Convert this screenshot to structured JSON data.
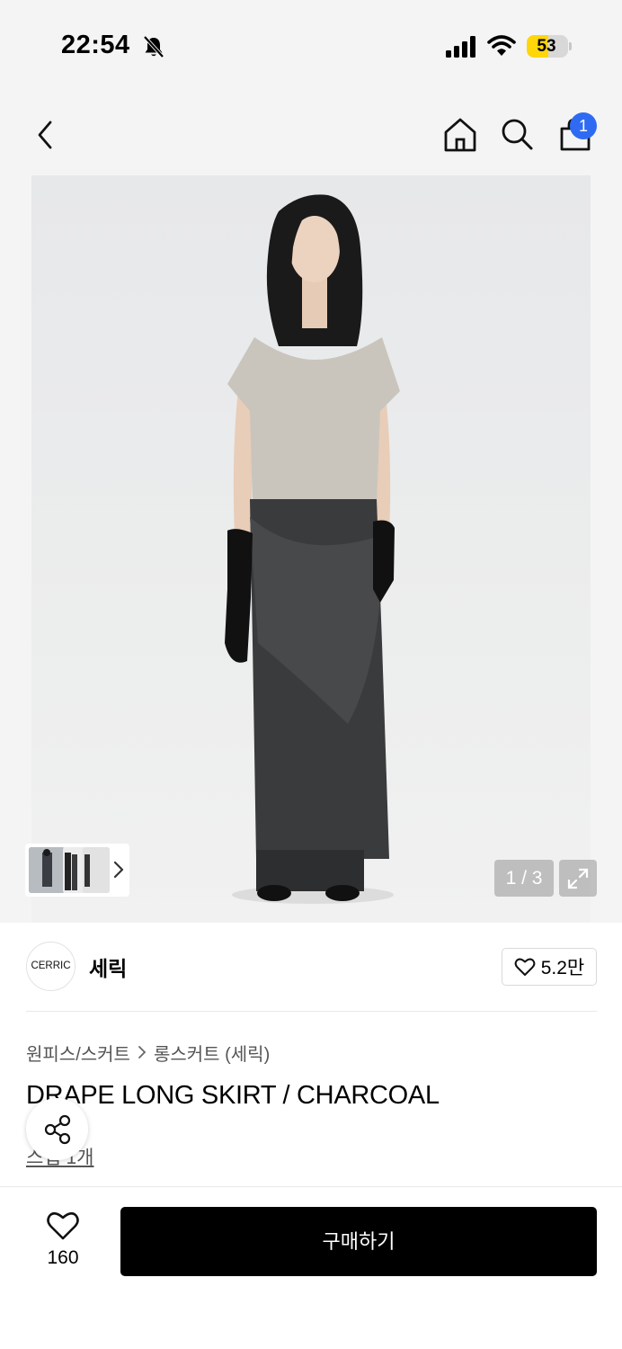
{
  "status_bar": {
    "time": "22:54",
    "battery_level": "53",
    "battery_fraction": 0.53,
    "battery_color": "#ffd60a",
    "icons": [
      "bell-slash-icon",
      "signal-icon",
      "wifi-icon",
      "battery-icon"
    ]
  },
  "nav": {
    "icons": [
      "chevron-left-icon",
      "home-icon",
      "search-icon",
      "shopping-bag-icon"
    ],
    "cart_count": "1",
    "badge_color": "#2e6bf2"
  },
  "gallery": {
    "counter": "1 / 3",
    "current": 1,
    "total": 3,
    "icons": [
      "chevron-right-icon",
      "expand-icon"
    ]
  },
  "brand": {
    "logo_text": "CERRIC",
    "name": "세릭",
    "like_count": "5.2만"
  },
  "product": {
    "breadcrumb": [
      "원피스/스커트",
      "롱스커트 (세릭)"
    ],
    "title": "DRAPE LONG SKIRT / CHARCOAL",
    "review_link": "스냅 1개"
  },
  "bottom_bar": {
    "wish_count": "160",
    "buy_label": "구매하기"
  }
}
